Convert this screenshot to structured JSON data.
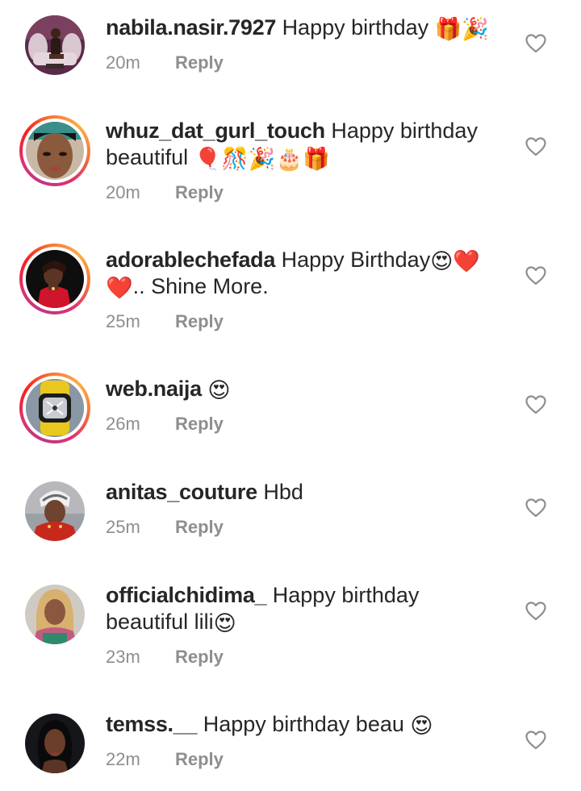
{
  "comments": [
    {
      "username": "nabila.nasir.7927",
      "text": "Happy birthday",
      "line2": "",
      "emoji": "🎁🎉",
      "time": "20m",
      "reply_label": "Reply",
      "story_ring": false,
      "avatar_icon": "avatar-photo-woman-on-chair"
    },
    {
      "username": "whuz_dat_gurl_touch",
      "text": "Happy birthday",
      "line2": "beautiful",
      "emoji": "🎈🎊🎉🎂🎁",
      "time": "20m",
      "reply_label": "Reply",
      "story_ring": true,
      "avatar_icon": "avatar-photo-woman-face"
    },
    {
      "username": "adorablechefada",
      "text": "Happy Birthday",
      "emoji": "😍❤️",
      "line2_emoji": "❤️",
      "line2": ".. Shine More.",
      "time": "25m",
      "reply_label": "Reply",
      "story_ring": true,
      "avatar_icon": "avatar-photo-woman-red"
    },
    {
      "username": "web.naija",
      "text": "",
      "line2": "",
      "emoji": "😍",
      "time": "26m",
      "reply_label": "Reply",
      "story_ring": true,
      "avatar_icon": "avatar-photo-watch"
    },
    {
      "username": "anitas_couture",
      "text": "Hbd",
      "line2": "",
      "emoji": "",
      "time": "25m",
      "reply_label": "Reply",
      "story_ring": false,
      "avatar_icon": "avatar-photo-woman-headwrap"
    },
    {
      "username": "officialchidima_",
      "text": "Happy birthday",
      "line2": "beautiful lili",
      "emoji": "😍",
      "time": "23m",
      "reply_label": "Reply",
      "story_ring": false,
      "avatar_icon": "avatar-photo-woman-blonde"
    },
    {
      "username": "temss.__",
      "text": "Happy birthday beau",
      "line2": "",
      "emoji": "😍",
      "time": "22m",
      "reply_label": "Reply",
      "story_ring": false,
      "avatar_icon": "avatar-photo-woman-dark"
    }
  ],
  "like_icon": "heart-outline-icon",
  "colors": {
    "text": "#262626",
    "meta": "#8e8e8e",
    "story_ring_start": "#c13584",
    "story_ring_end": "#fcaf45",
    "background": "#ffffff"
  }
}
